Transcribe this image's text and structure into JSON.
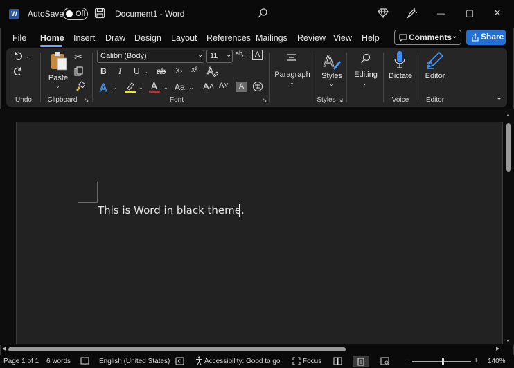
{
  "titlebar": {
    "logo_letter": "W",
    "autosave_label": "AutoSave",
    "autosave_state": "Off",
    "document_title": "Document1  -  Word",
    "search_icon": "search-icon",
    "minimize": "—",
    "maximize": "▢",
    "close": "✕"
  },
  "menu": {
    "tabs": [
      "File",
      "Home",
      "Insert",
      "Draw",
      "Design",
      "Layout",
      "References",
      "Mailings",
      "Review",
      "View",
      "Help"
    ],
    "active": "Home",
    "comments_label": "Comments",
    "share_label": "Share"
  },
  "ribbon": {
    "groups": {
      "undo": "Undo",
      "clipboard": "Clipboard",
      "font": "Font",
      "styles": "Styles",
      "voice": "Voice",
      "editor": "Editor"
    },
    "paste_label": "Paste",
    "font_name": "Calibri (Body)",
    "font_size": "11",
    "paragraph_label": "Paragraph",
    "styles_label": "Styles",
    "editing_label": "Editing",
    "dictate_label": "Dictate",
    "editor_label": "Editor",
    "format_buttons": {
      "bold": "B",
      "italic": "I",
      "underline": "U",
      "strike": "ab",
      "subscript": "x₂",
      "superscript": "x²",
      "grow": "A˄",
      "shrink": "A˅",
      "case": "Aa"
    },
    "colors": {
      "highlight": "#f2e600",
      "font_color": "#e02020",
      "accent": "#2170d8"
    }
  },
  "document": {
    "text": "This is Word in black theme."
  },
  "status": {
    "page": "Page 1 of 1",
    "words": "6 words",
    "language": "English (United States)",
    "accessibility": "Accessibility: Good to go",
    "focus": "Focus",
    "zoom_minus": "−",
    "zoom_plus": "+",
    "zoom": "140%"
  }
}
